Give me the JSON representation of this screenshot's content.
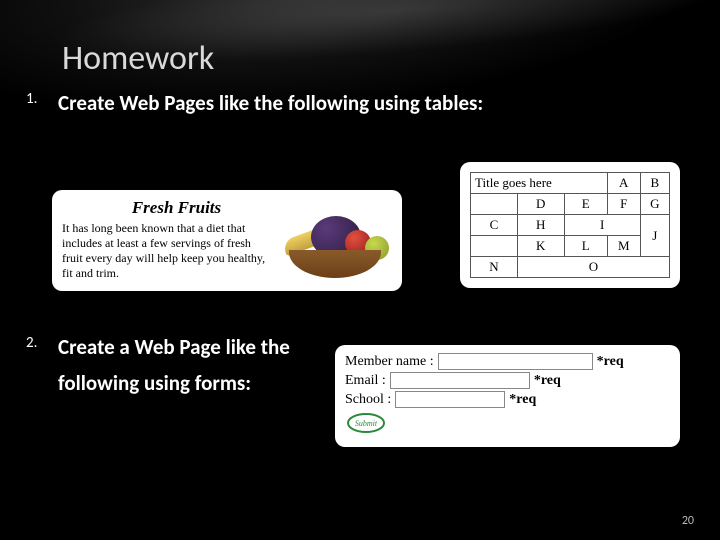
{
  "title": "Homework",
  "list": {
    "item1": {
      "num": "1.",
      "text": "Create Web Pages like the following using tables:"
    },
    "item2": {
      "num": "2.",
      "text": "Create a Web Page like the following using forms:"
    }
  },
  "fruits": {
    "title": "Fresh Fruits",
    "body": "It has long been known that a diet that includes at least a few servings of fresh fruit every day will help keep you healthy, fit and trim."
  },
  "table": {
    "r0": {
      "c0": "Title goes here",
      "c1": "A",
      "c2": "B"
    },
    "r1": {
      "c0": "D",
      "c1": "E",
      "c3": "F",
      "c4": "G"
    },
    "r2": {
      "c0": "C",
      "c1": "H",
      "c2": "I"
    },
    "r3": {
      "c0": "K",
      "c1": "L",
      "c2": "M",
      "c3": "J"
    },
    "r4": {
      "c0": "N",
      "c1": "O"
    }
  },
  "form": {
    "member_label": "Member name :",
    "email_label": "Email :",
    "school_label": "School :",
    "req": "*req",
    "submit_text": "Submit"
  },
  "slide_num": "20"
}
